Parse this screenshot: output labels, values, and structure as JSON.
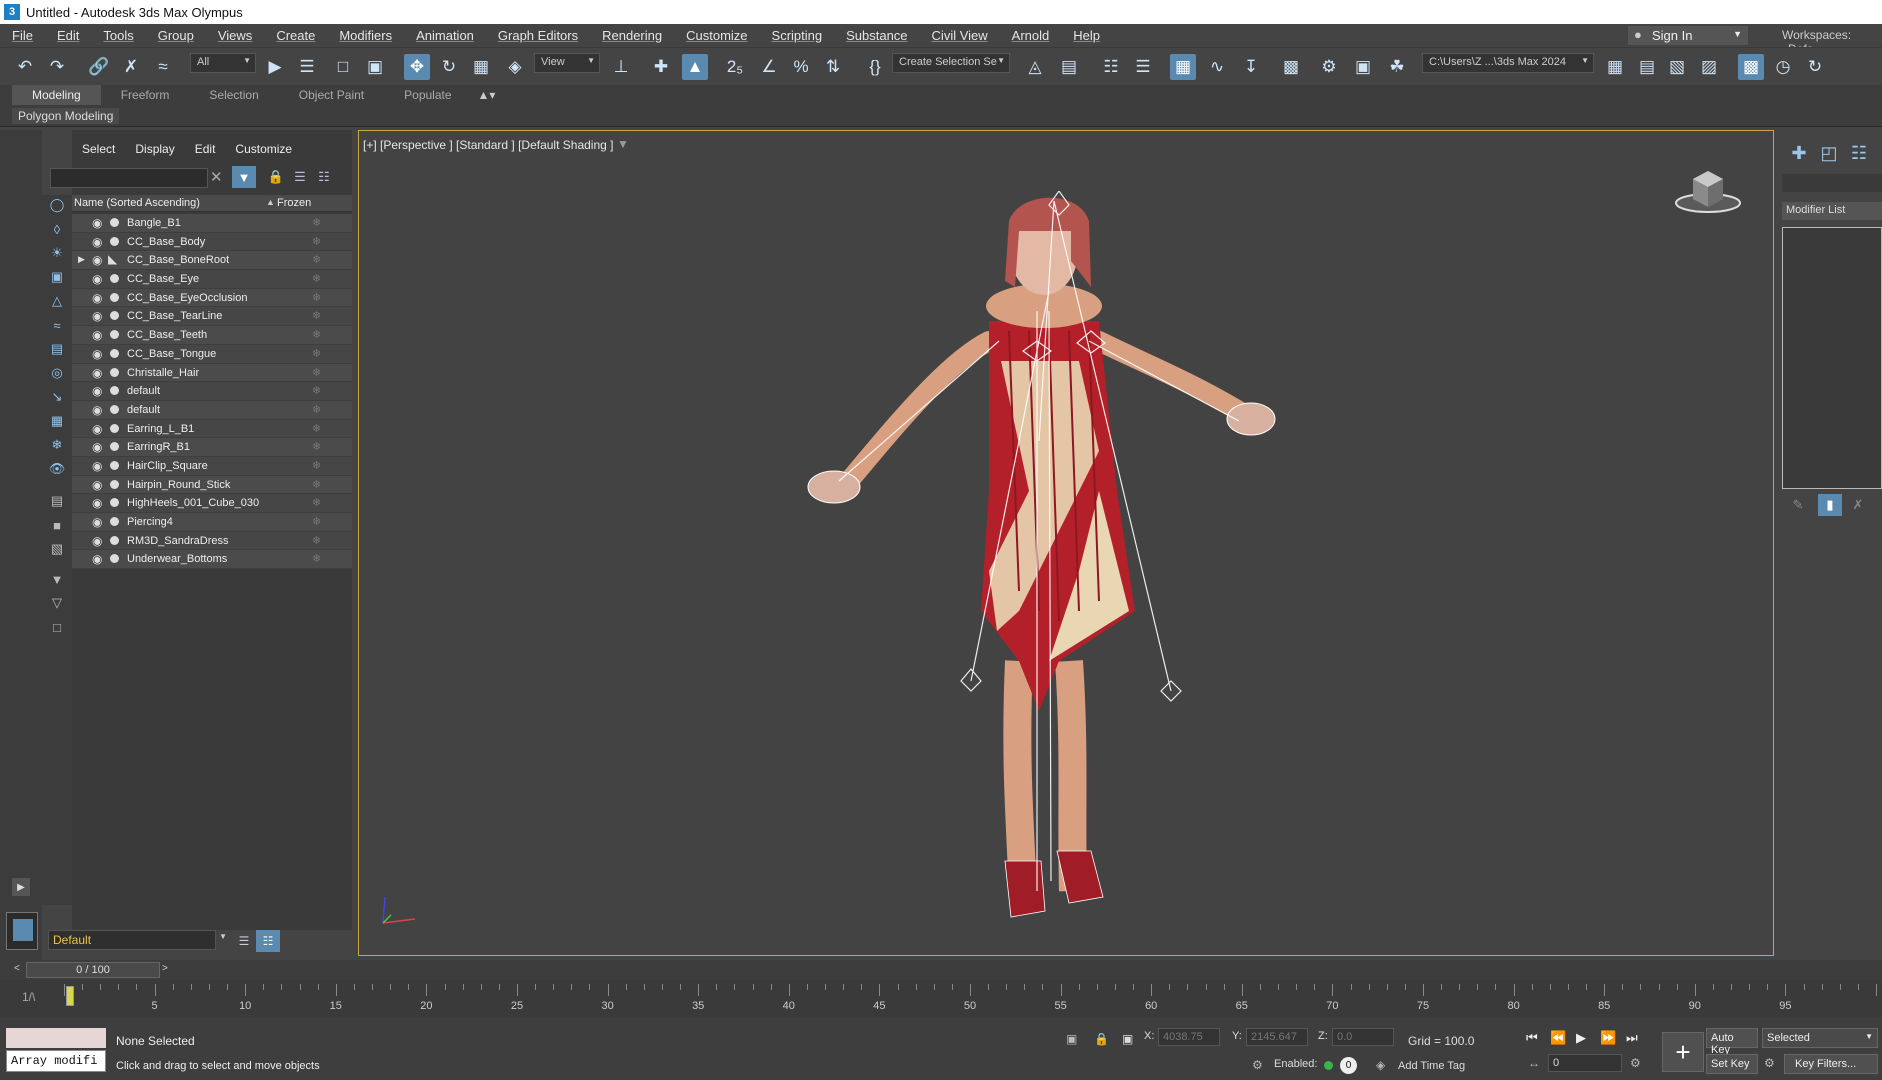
{
  "window": {
    "title": "Untitled - Autodesk 3ds Max Olympus",
    "app_icon": "3"
  },
  "menu": [
    "File",
    "Edit",
    "Tools",
    "Group",
    "Views",
    "Create",
    "Modifiers",
    "Animation",
    "Graph Editors",
    "Rendering",
    "Customize",
    "Scripting",
    "Substance",
    "Civil View",
    "Arnold",
    "Help"
  ],
  "signin": {
    "label": "Sign In"
  },
  "workspaces": {
    "label": "Workspaces:",
    "value": "Defa"
  },
  "toolbar": {
    "filter_select": "All",
    "ref_coord": "View",
    "selection_set": "Create Selection Se",
    "project_path": "C:\\Users\\Z ...\\3ds Max 2024"
  },
  "ribbon": {
    "tabs": [
      "Modeling",
      "Freeform",
      "Selection",
      "Object Paint",
      "Populate"
    ],
    "active": "Modeling",
    "sub_label": "Polygon Modeling"
  },
  "scene_explorer": {
    "menu": [
      "Select",
      "Display",
      "Edit",
      "Customize"
    ],
    "columns": {
      "name": "Name (Sorted Ascending)",
      "frozen": "Frozen"
    },
    "items": [
      {
        "name": "Bangle_B1",
        "type": "mesh"
      },
      {
        "name": "CC_Base_Body",
        "type": "mesh"
      },
      {
        "name": "CC_Base_BoneRoot",
        "type": "bone",
        "expandable": true
      },
      {
        "name": "CC_Base_Eye",
        "type": "mesh"
      },
      {
        "name": "CC_Base_EyeOcclusion",
        "type": "mesh"
      },
      {
        "name": "CC_Base_TearLine",
        "type": "mesh"
      },
      {
        "name": "CC_Base_Teeth",
        "type": "mesh"
      },
      {
        "name": "CC_Base_Tongue",
        "type": "mesh"
      },
      {
        "name": "Christalle_Hair",
        "type": "mesh"
      },
      {
        "name": "default",
        "type": "mesh"
      },
      {
        "name": "default",
        "type": "mesh"
      },
      {
        "name": "Earring_L_B1",
        "type": "mesh"
      },
      {
        "name": "EarringR_B1",
        "type": "mesh"
      },
      {
        "name": "HairClip_Square",
        "type": "mesh"
      },
      {
        "name": "Hairpin_Round_Stick",
        "type": "mesh"
      },
      {
        "name": "HighHeels_001_Cube_030",
        "type": "mesh"
      },
      {
        "name": "Piercing4",
        "type": "mesh"
      },
      {
        "name": "RM3D_SandraDress",
        "type": "mesh"
      },
      {
        "name": "Underwear_Bottoms",
        "type": "mesh"
      }
    ],
    "layer": "Default"
  },
  "viewport": {
    "label": "[+] [Perspective ] [Standard ] [Default Shading ]"
  },
  "command_panel": {
    "modifier_list": "Modifier List"
  },
  "time": {
    "slider_label": "0 / 100",
    "ticks": [
      5,
      10,
      15,
      20,
      25,
      30,
      35,
      40,
      45,
      50,
      55,
      60,
      65,
      70,
      75,
      80,
      85,
      90,
      95
    ]
  },
  "status": {
    "selection": "None Selected",
    "prompt": "Click and drag to select and move objects",
    "maxscript": "Array modifi",
    "x_label": "X:",
    "x": "4038.75",
    "y_label": "Y:",
    "y": "2145.647",
    "z_label": "Z:",
    "z": "0.0",
    "grid": "Grid = 100.0",
    "enabled": "Enabled:",
    "enabled_count": "0",
    "add_time_tag": "Add Time Tag",
    "frame": "0",
    "auto_key": "Auto Key",
    "set_key": "Set Key",
    "key_mode": "Selected",
    "key_filters": "Key Filters..."
  },
  "colors": {
    "accent": "#5a8ab0",
    "viewport_border": "#c9a544",
    "dress_red": "#b3202a",
    "dress_cream": "#e9d7b4",
    "skin": "#d8a080",
    "hair": "#b3544e"
  }
}
